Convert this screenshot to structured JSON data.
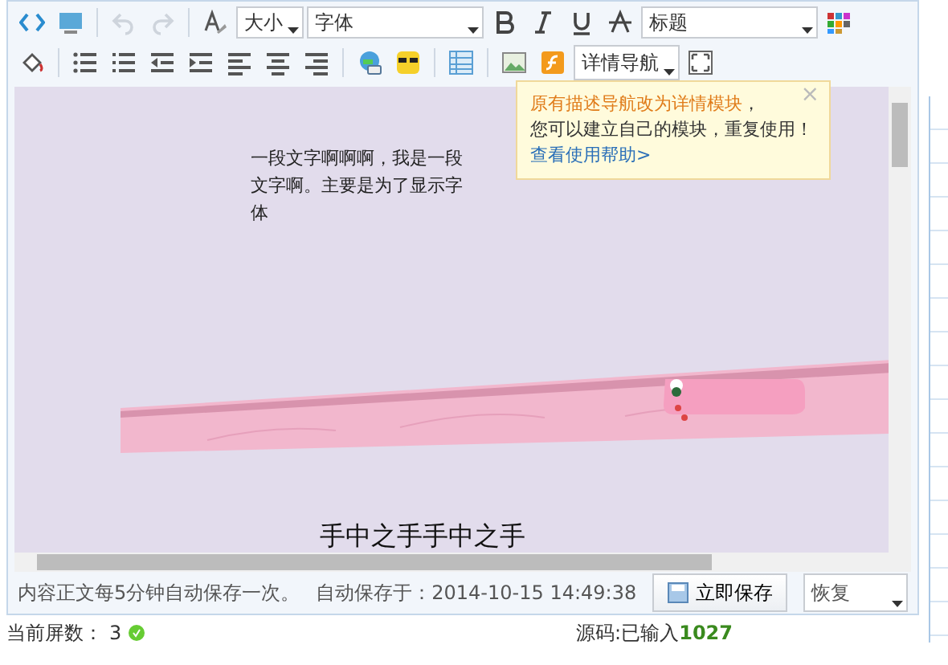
{
  "toolbar_rows": [
    [
      {
        "kind": "icon",
        "disabled": false
      },
      {
        "kind": "icon",
        "disabled": false
      },
      {
        "kind": "sep"
      },
      {
        "kind": "icon",
        "disabled": true
      },
      {
        "kind": "icon",
        "disabled": true
      },
      {
        "kind": "sep"
      },
      {
        "kind": "icon",
        "disabled": false
      },
      {
        "kind": "dropdown",
        "label": "大小",
        "wide": false
      },
      {
        "kind": "dropdown",
        "label": "字体",
        "wide": true
      },
      {
        "kind": "icon",
        "disabled": false
      },
      {
        "kind": "icon",
        "disabled": false
      },
      {
        "kind": "icon",
        "disabled": false
      },
      {
        "kind": "icon",
        "disabled": false
      },
      {
        "kind": "dropdown",
        "label": "标题",
        "wide": true
      },
      {
        "kind": "icon",
        "disabled": false
      }
    ],
    [
      {
        "kind": "icon",
        "disabled": false
      },
      {
        "kind": "sep"
      },
      {
        "kind": "icon",
        "disabled": false
      },
      {
        "kind": "icon",
        "disabled": false
      },
      {
        "kind": "icon",
        "disabled": false
      },
      {
        "kind": "icon",
        "disabled": false
      },
      {
        "kind": "icon",
        "disabled": false
      },
      {
        "kind": "icon",
        "disabled": false
      },
      {
        "kind": "icon",
        "disabled": false
      },
      {
        "kind": "sep"
      },
      {
        "kind": "icon",
        "disabled": false
      },
      {
        "kind": "icon",
        "disabled": false
      },
      {
        "kind": "sep"
      },
      {
        "kind": "icon",
        "disabled": false
      },
      {
        "kind": "sep"
      },
      {
        "kind": "icon",
        "disabled": false
      },
      {
        "kind": "icon",
        "disabled": false
      },
      {
        "kind": "dropdown",
        "label": "详情导航",
        "wide": false
      },
      {
        "kind": "icon",
        "disabled": false
      }
    ]
  ],
  "tooltip": {
    "title": "原有描述导航改为详情模块",
    "title_tail": "，",
    "line": "您可以建立自己的模块，重复使用！",
    "link": "查看使用帮助>",
    "close": "×"
  },
  "content": {
    "paragraph": "一段文字啊啊啊，我是一段文字啊。主要是为了显示字体",
    "heading": "手中之手手中之手"
  },
  "status": {
    "note": "内容正文每5分钟自动保存一次。",
    "autosave": "自动保存于：2014-10-15 14:49:38",
    "save_button": "立即保存",
    "restore": "恢复"
  },
  "footer": {
    "screens_label": "当前屏数：",
    "screens": "3",
    "source_label": "源码:已输入",
    "source_count": "1027"
  }
}
